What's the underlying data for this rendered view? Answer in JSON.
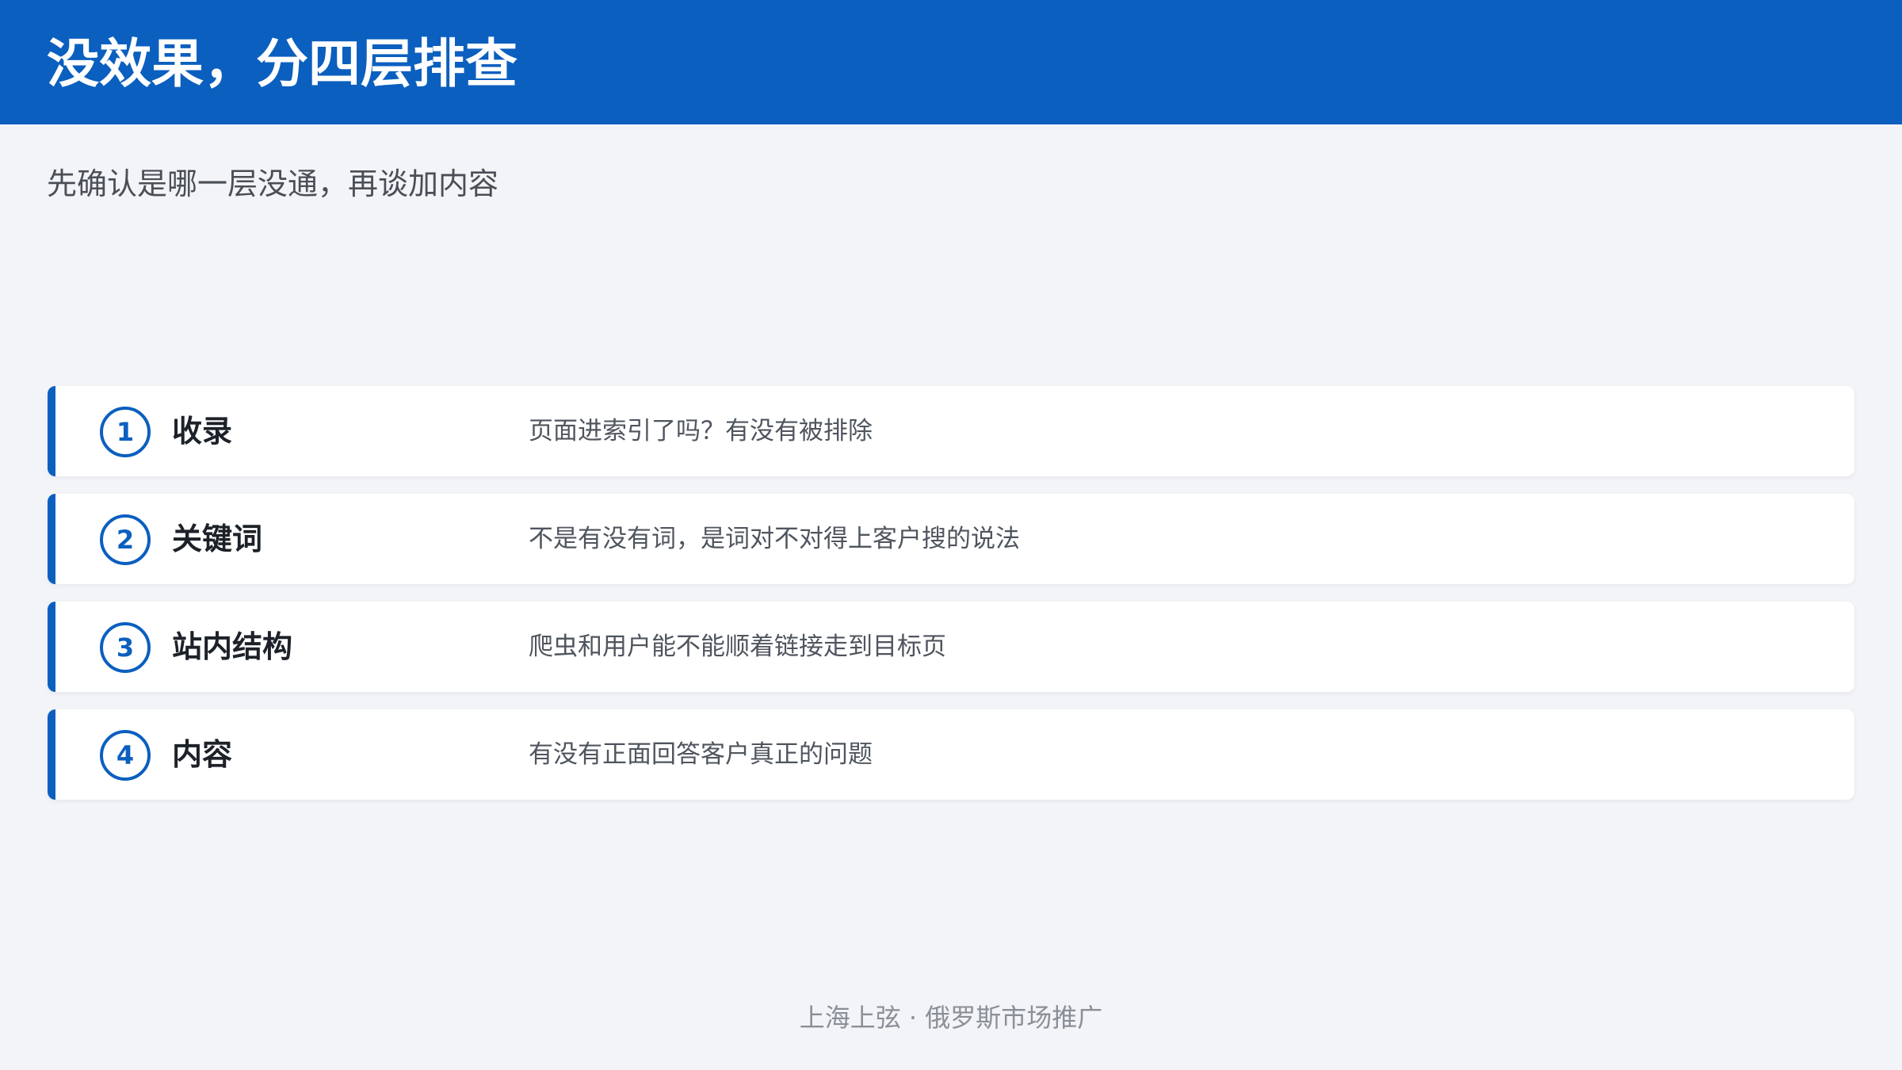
{
  "header": {
    "title": "没效果，分四层排查"
  },
  "subtitle": "先确认是哪一层没通，再谈加内容",
  "items": [
    {
      "number": "1",
      "title": "收录",
      "description": "页面进索引了吗？有没有被排除"
    },
    {
      "number": "2",
      "title": "关键词",
      "description": "不是有没有词，是词对不对得上客户搜的说法"
    },
    {
      "number": "3",
      "title": "站内结构",
      "description": "爬虫和用户能不能顺着链接走到目标页"
    },
    {
      "number": "4",
      "title": "内容",
      "description": "有没有正面回答客户真正的问题"
    }
  ],
  "footer": "上海上弦 · 俄罗斯市场推广",
  "colors": {
    "accent": "#0b5fbf",
    "background": "#f3f4f7",
    "card": "#ffffff"
  }
}
